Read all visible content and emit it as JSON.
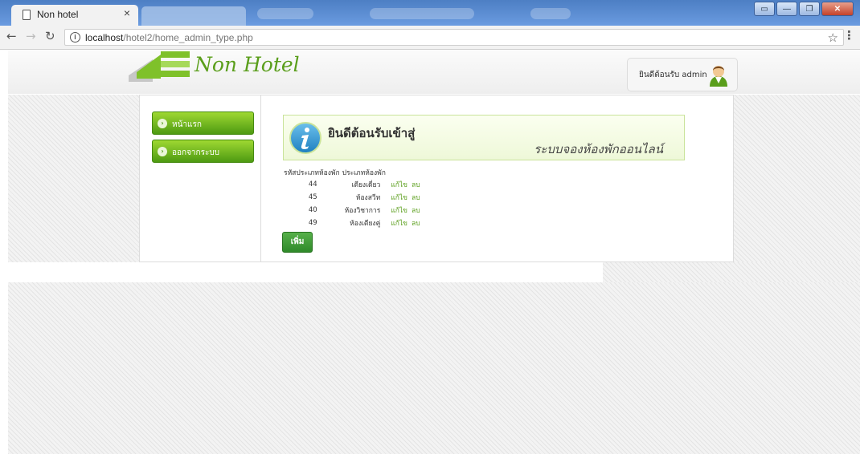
{
  "browser": {
    "tab_title": "Non hotel",
    "tab_close": "×",
    "url_host": "localhost",
    "url_path": "/hotel2/home_admin_type.php",
    "window_buttons": [
      "▭",
      "—",
      "❐",
      "✕"
    ]
  },
  "header": {
    "logo_text": "Non Hotel",
    "welcome_text": "ยินดีต้อนรับ admin"
  },
  "sidebar": {
    "items": [
      {
        "label": "หน้าแรก"
      },
      {
        "label": "ออกจากระบบ"
      }
    ]
  },
  "main": {
    "info_title": "ยินดีต้อนรับเข้าสู่",
    "info_subtitle": "ระบบจองห้องพักออนไลน์",
    "table": {
      "headers": [
        "รหัสประเภทห้องพัก",
        "ประเภทห้องพัก"
      ],
      "rows": [
        {
          "id": "44",
          "name": "เตียงเดี่ยว",
          "edit": "แก้ไข",
          "delete": "ลบ"
        },
        {
          "id": "45",
          "name": "ห้องสวีท",
          "edit": "แก้ไข",
          "delete": "ลบ"
        },
        {
          "id": "40",
          "name": "ห้องวิชาการ",
          "edit": "แก้ไข",
          "delete": "ลบ"
        },
        {
          "id": "49",
          "name": "ห้องเตียงคู่",
          "edit": "แก้ไข",
          "delete": "ลบ"
        }
      ]
    },
    "add_label": "เพิ่ม"
  },
  "colors": {
    "accent_green": "#5a9e1b",
    "button_green": "#4d9a12",
    "titlebar_blue": "#4d7fc4"
  }
}
